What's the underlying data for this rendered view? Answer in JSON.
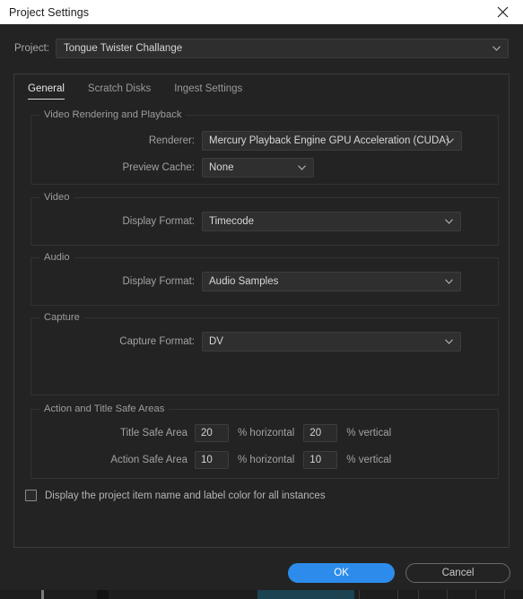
{
  "window": {
    "title": "Project Settings",
    "close_icon": "close-icon"
  },
  "project": {
    "label": "Project:",
    "value": "Tongue Twister Challange",
    "chevron_icon": "chevron-down-icon"
  },
  "tabs": [
    {
      "label": "General",
      "active": true
    },
    {
      "label": "Scratch Disks",
      "active": false
    },
    {
      "label": "Ingest Settings",
      "active": false
    }
  ],
  "groups": {
    "video_rendering": {
      "title": "Video Rendering and Playback",
      "renderer": {
        "label": "Renderer:",
        "value": "Mercury Playback Engine GPU Acceleration (CUDA)"
      },
      "preview_cache": {
        "label": "Preview Cache:",
        "value": "None"
      }
    },
    "video": {
      "title": "Video",
      "display_format": {
        "label": "Display Format:",
        "value": "Timecode"
      }
    },
    "audio": {
      "title": "Audio",
      "display_format": {
        "label": "Display Format:",
        "value": "Audio Samples"
      }
    },
    "capture": {
      "title": "Capture",
      "capture_format": {
        "label": "Capture Format:",
        "value": "DV"
      }
    },
    "safe_areas": {
      "title": "Action and Title Safe Areas",
      "title_safe": {
        "label": "Title Safe Area",
        "horizontal_value": "20",
        "horizontal_unit": "% horizontal",
        "vertical_value": "20",
        "vertical_unit": "% vertical"
      },
      "action_safe": {
        "label": "Action Safe Area",
        "horizontal_value": "10",
        "horizontal_unit": "% horizontal",
        "vertical_value": "10",
        "vertical_unit": "% vertical"
      }
    }
  },
  "checkbox": {
    "label": "Display the project item name and label color for all instances",
    "checked": false
  },
  "footer": {
    "ok_label": "OK",
    "cancel_label": "Cancel"
  },
  "colors": {
    "accent": "#2d8ceb",
    "titlebar_bg": "#ffffff",
    "dialog_bg": "#232323",
    "field_bg": "#2f2f2f",
    "text_primary": "#d8d8d8",
    "text_muted": "#a2a2a2"
  }
}
